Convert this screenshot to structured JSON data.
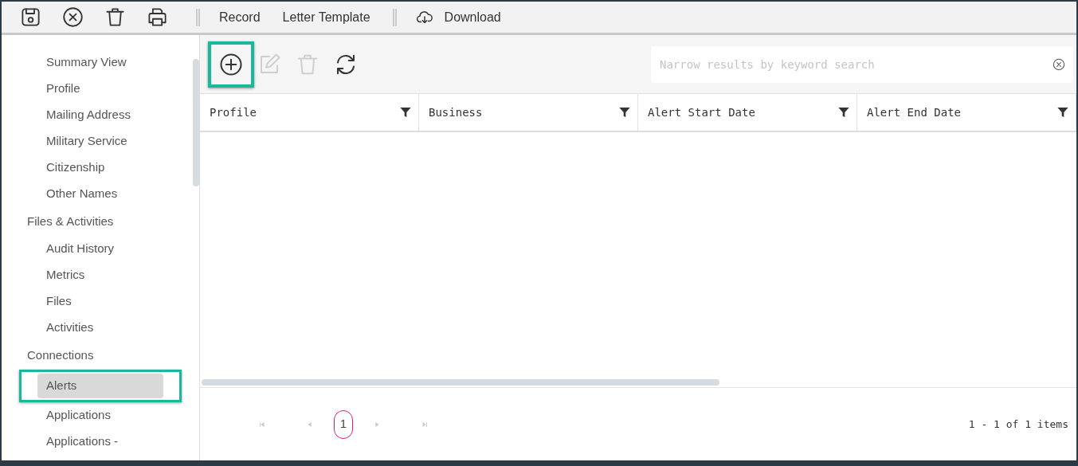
{
  "toolbar": {
    "icon_buttons": [
      {
        "kind": "save"
      },
      {
        "kind": "cancel"
      },
      {
        "kind": "delete"
      },
      {
        "kind": "print"
      }
    ],
    "menu_items": [
      "Record",
      "Letter Template"
    ],
    "download": {
      "label": "Download"
    }
  },
  "sidebar": {
    "groups": [
      {
        "items": [
          {
            "label": "Summary View",
            "selected": false,
            "highlighted": false
          },
          {
            "label": "Profile",
            "selected": false,
            "highlighted": false
          },
          {
            "label": "Mailing Address",
            "selected": false,
            "highlighted": false
          },
          {
            "label": "Military Service",
            "selected": false,
            "highlighted": false
          },
          {
            "label": "Citizenship",
            "selected": false,
            "highlighted": false
          },
          {
            "label": "Other Names",
            "selected": false,
            "highlighted": false
          }
        ]
      },
      {
        "label": "Files & Activities",
        "items": [
          {
            "label": "Audit History",
            "selected": false,
            "highlighted": false
          },
          {
            "label": "Metrics",
            "selected": false,
            "highlighted": false
          },
          {
            "label": "Files",
            "selected": false,
            "highlighted": false
          },
          {
            "label": "Activities",
            "selected": false,
            "highlighted": false
          }
        ]
      },
      {
        "label": "Connections",
        "items": [
          {
            "label": "Alerts",
            "selected": true,
            "highlighted": true
          },
          {
            "label": "Applications",
            "selected": false,
            "highlighted": false
          },
          {
            "label": "Applications -",
            "selected": false,
            "highlighted": false
          }
        ]
      }
    ]
  },
  "grid": {
    "actions": [
      {
        "kind": "add",
        "disabled": false,
        "highlighted": true
      },
      {
        "kind": "edit",
        "disabled": true,
        "highlighted": false
      },
      {
        "kind": "delete",
        "disabled": true,
        "highlighted": false
      },
      {
        "kind": "refresh",
        "disabled": false,
        "highlighted": false
      }
    ],
    "search": {
      "placeholder": "Narrow results by keyword search"
    },
    "columns": [
      "Profile",
      "Business",
      "Alert Start Date",
      "Alert End Date"
    ],
    "pager": {
      "buttons": [
        {
          "kind": "first",
          "disabled": true
        },
        {
          "kind": "prev",
          "disabled": true
        }
      ],
      "pages": [
        {
          "label": "1",
          "selected": true
        }
      ],
      "after": [
        {
          "kind": "next",
          "disabled": true
        },
        {
          "kind": "last",
          "disabled": true
        }
      ],
      "info": "1 - 1 of 1 items"
    }
  }
}
